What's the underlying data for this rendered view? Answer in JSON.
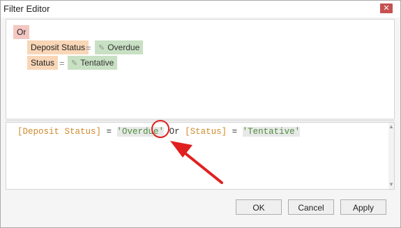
{
  "window": {
    "title": "Filter Editor",
    "close_glyph": "✕"
  },
  "tree": {
    "root_operator": "Or",
    "conditions": [
      {
        "field": "Deposit Status",
        "operator": "=",
        "value": "Overdue"
      },
      {
        "field": "Status",
        "operator": "=",
        "value": "Tentative"
      }
    ]
  },
  "expression": {
    "field1": "[Deposit Status]",
    "op1": " = ",
    "value1": "'Overdue'",
    "join": " Or ",
    "field2": "[Status]",
    "op2": " = ",
    "value2": "'Tentative'"
  },
  "scrollbar": {
    "up_glyph": "▲",
    "down_glyph": "▼"
  },
  "buttons": {
    "ok": "OK",
    "cancel": "Cancel",
    "apply": "Apply"
  },
  "colors": {
    "operator_chip": "#f4c7c3",
    "field_chip": "#f8d6b7",
    "value_chip": "#c8e0c3",
    "annotation_red": "#e02020"
  },
  "icons": {
    "value_edit": "pencil-icon",
    "annotation": "red-arrow"
  }
}
